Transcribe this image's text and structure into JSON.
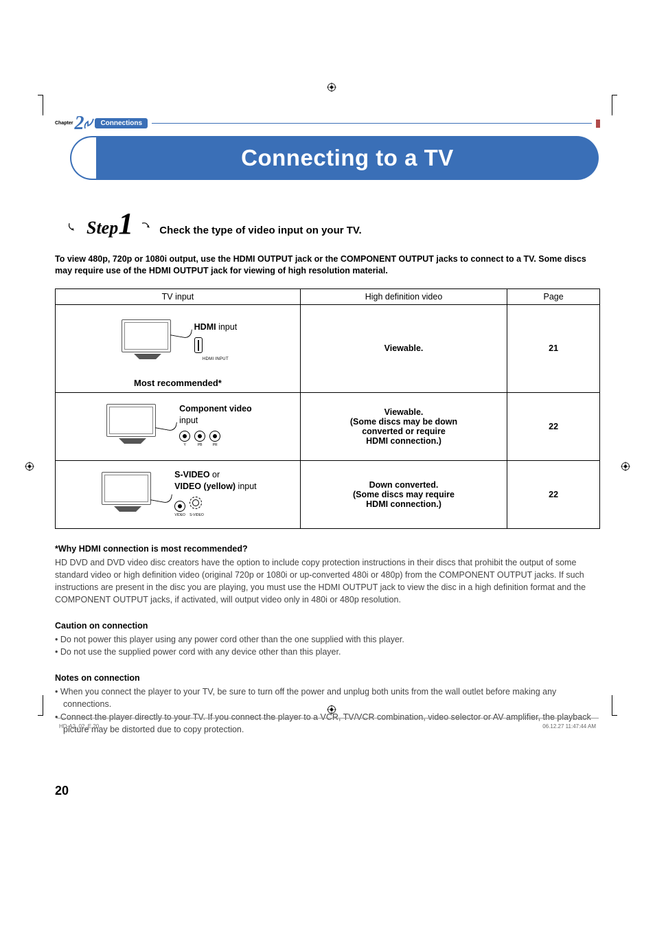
{
  "chapter": {
    "label": "Chapter",
    "number": "2",
    "badge": "Connections"
  },
  "title": "Connecting to a TV",
  "step": {
    "prefix": "Step",
    "number": "1",
    "desc": "Check the type of video input on your TV."
  },
  "intro": "To view 480p, 720p or 1080i output, use the HDMI OUTPUT jack or the COMPONENT OUTPUT jacks to connect to  a TV. Some discs may require use of the HDMI OUTPUT jack for viewing of high resolution material.",
  "table": {
    "headers": {
      "c1": "TV input",
      "c2": "High definition video",
      "c3": "Page"
    },
    "rows": [
      {
        "label_bold": "HDMI",
        "label_rest": " input",
        "port_sub": "HDMI INPUT",
        "recommend": "Most recommended*",
        "hd": "Viewable.",
        "page": "21"
      },
      {
        "label_bold": "Component video",
        "label_rest": "\ninput",
        "port_labels": [
          "Y",
          "PB",
          "PR"
        ],
        "hd": "Viewable.\n(Some discs may be down\nconverted or require\nHDMI connection.)",
        "page": "22"
      },
      {
        "label_bold1": "S-VIDEO",
        "label_mid": " or",
        "label_bold2": "VIDEO (yellow)",
        "label_rest": " input",
        "port_labels": [
          "VIDEO",
          "S-VIDEO"
        ],
        "hd": "Down converted.\n(Some discs may require\nHDMI connection.)",
        "page": "22"
      }
    ]
  },
  "why": {
    "head": "*Why HDMI connection is most recommended?",
    "body": "HD DVD and DVD video disc creators have the option to include copy protection instructions in their discs that prohibit the output of some standard video or high definition video (original 720p or 1080i or up-converted 480i or 480p) from the COMPONENT OUTPUT jacks. If such instructions are present in the disc you are playing, you must use the HDMI OUTPUT jack to view the disc in a high definition format and the COMPONENT OUTPUT jacks, if activated, will output video only in 480i or 480p resolution."
  },
  "caution": {
    "head": "Caution on connection",
    "items": [
      "Do not power this player using any power cord other than the one supplied with this player.",
      "Do not use the supplied power cord with any device other than this player."
    ]
  },
  "notes": {
    "head": "Notes on connection",
    "items": [
      "When you connect the player to your TV, be sure to turn off the power and unplug both units from the wall outlet before making any connections.",
      "Connect the player directly to your TV. If you connect the player to a VCR, TV/VCR combination, video selector or AV amplifier, the playback picture may be distorted due to copy protection."
    ]
  },
  "page_number": "20",
  "footer": {
    "left": "HD-A2_02_E   20",
    "right": "06.12.27   11:47:44 AM"
  }
}
